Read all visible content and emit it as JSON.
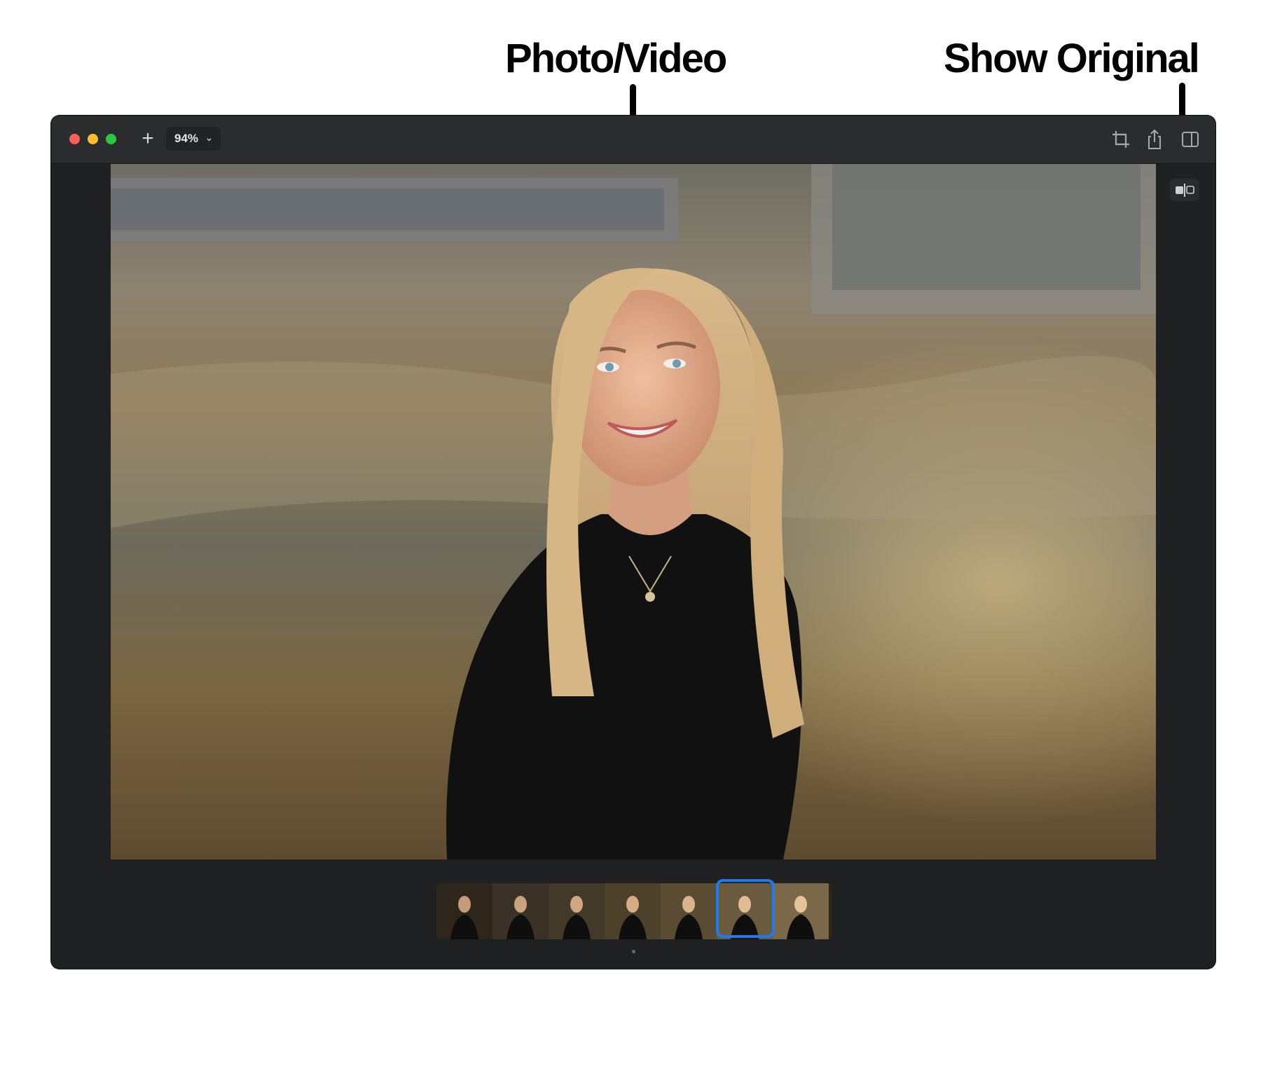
{
  "callouts": {
    "photo_video": "Photo/Video",
    "show_original": "Show Original"
  },
  "toolbar": {
    "add_icon": "plus-icon",
    "zoom_value": "94%",
    "right_icons": [
      "crop-icon",
      "share-icon",
      "info-icon"
    ]
  },
  "filmstrip": {
    "frame_count": 7,
    "selected_index": 5
  },
  "colors": {
    "window_bg": "#1f2022",
    "toolbar_bg": "#2b2c2e",
    "selection": "#1a7cf0",
    "close": "#fe5f57",
    "minimize": "#febc2e",
    "maximize": "#28c840"
  }
}
